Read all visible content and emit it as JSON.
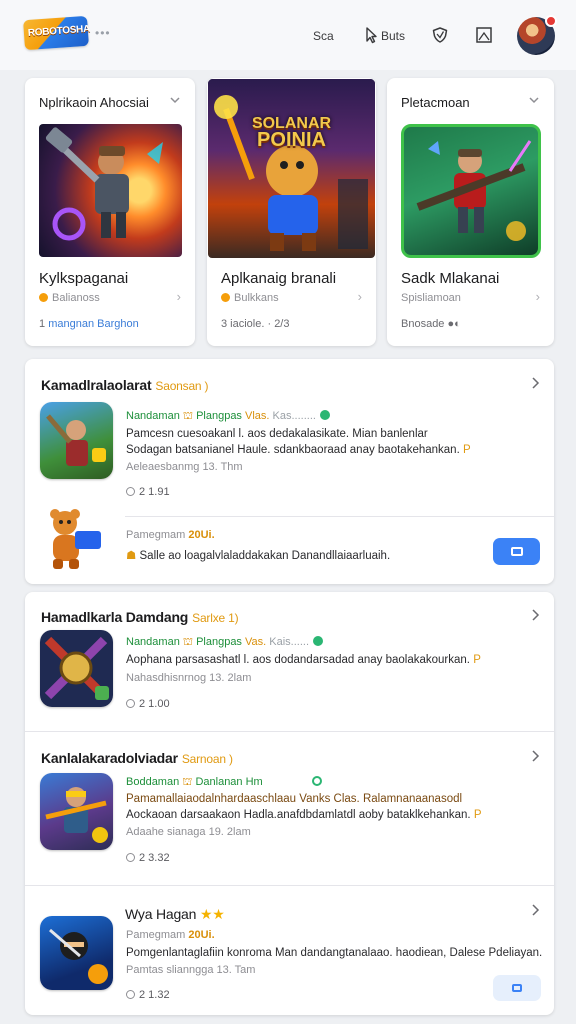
{
  "header": {
    "logo_text": "ROBOTOSHA",
    "more": "•••",
    "nav_text_1": "Sca",
    "nav_text_2": "Buts",
    "nav_icon_2": "pointer-icon",
    "icon_3": "shield-icon",
    "icon_4": "image-icon",
    "avatar": "user-avatar"
  },
  "top_cards": [
    {
      "header": "Nplrikaoin Ahocsiai",
      "name": "Kylkspaganai",
      "sub": "Balianoss",
      "meta": "1",
      "meta_link": "mangnan Barghon",
      "arrow": "›"
    },
    {
      "header": "",
      "art_title_1": "SOLANAR",
      "art_title_2": "POINIA",
      "name": "Aplkanaig branali",
      "sub": "Bulkkans",
      "meta": "3  iaciole. · 2/3",
      "arrow": "›"
    },
    {
      "header": "Pletacmoan",
      "name": "Sadk Mlakanai",
      "sub": "Spisliamoan",
      "meta": "Bnosade",
      "meta_icon": "●◐",
      "arrow": "›"
    }
  ],
  "section_1": {
    "title": "Kamadlralaolarat",
    "tag": "Saonsan )",
    "rows": [
      {
        "line1_a": "Nandaman",
        "line1_b": "Plangpas",
        "line1_c": "Vlas.",
        "line1_d": "Kas........",
        "line2": "Pamcesn cuesoakanl l. aos dedakalasikate. Mian banlenlar",
        "line2b": "Sodagan batsanianel Haule. sdankbaoraad anay baotakehankan.",
        "pin": "P",
        "line3": "Aeleaesbanmg 13. Thm",
        "count": "2 1.91"
      },
      {
        "line1": "Pamegmam",
        "line1_gold": "20Ui.",
        "line2": "Salle ao loagalvlaladdakakan Danandllaiaarluaih.",
        "mascot": "bear-mascot"
      }
    ]
  },
  "section_2": {
    "title": "Hamadlkarla Damdang",
    "tag": "Sarlxe 1)",
    "rows": [
      {
        "line1_a": "Nandaman",
        "line1_b": "Plangpas",
        "line1_c": "Vas.",
        "line1_d": "Kais......",
        "line2": "Aophana parsasashatl l. aos dodandarsadad anay baolakakourkan.",
        "pin": "P",
        "line3": "Nahasdhisnrnog 13. 2lam",
        "count": "2 1.00"
      }
    ]
  },
  "section_3": {
    "title": "Kanlalakaradolviadar",
    "tag": "Sarnoan )",
    "rows": [
      {
        "line1_a": "Boddaman",
        "line1_b": "Danlanan",
        "line1_c": "Hm",
        "line2": "Pamamallaiaodalnhardaaschlaau Vanks Clas. Ralamnanaanasodl",
        "line2b": "Aockaoan darsaakaon Hadla.anafdbdamlatdl aoby bataklkehankan.",
        "pin": "P",
        "line3": "Adaahe sianaga 19. 2lam",
        "count": "2 3.32"
      },
      {
        "title": "Wya Hagan",
        "stars": "★★",
        "line1": "Pamegmam",
        "line1_gold": "20Ui.",
        "line2": "Pomgenlantaglafiin konroma Man dandangtanalaao. haodiean, Dalese Pdeliayan.",
        "line3": "Pamtas slianngga 13. Tam",
        "count": "2 1.32"
      }
    ]
  },
  "colors": {
    "accent_blue": "#3b82f6",
    "green": "#1d8f3a",
    "gold": "#e09a12",
    "background": "#eef0f3"
  }
}
